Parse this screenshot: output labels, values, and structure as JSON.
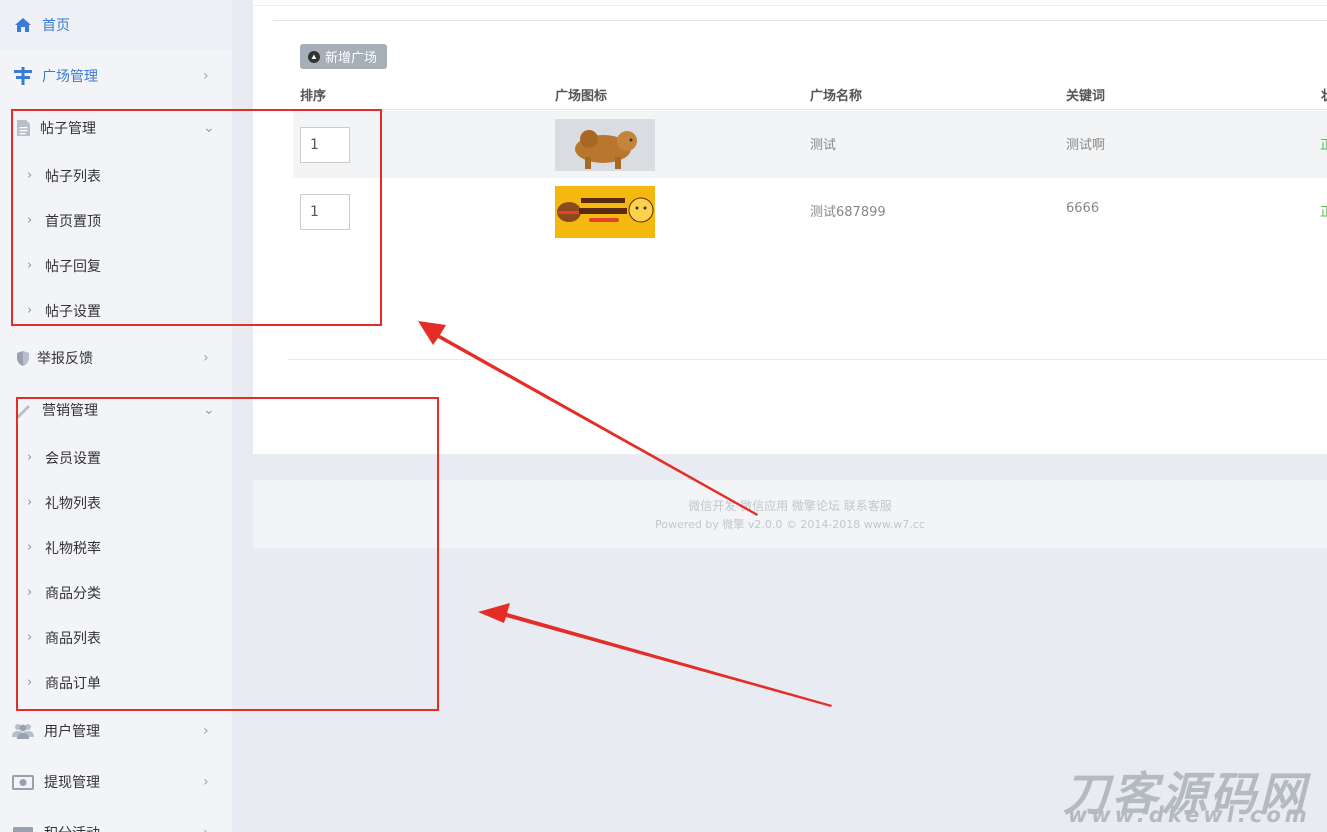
{
  "sidebar": {
    "items": [
      {
        "label": "首页",
        "icon": "home-icon"
      },
      {
        "label": "广场管理",
        "icon": "signpost-icon"
      },
      {
        "label": "帖子管理",
        "icon": "document-icon",
        "children": [
          "帖子列表",
          "首页置顶",
          "帖子回复",
          "帖子设置"
        ]
      },
      {
        "label": "举报反馈",
        "icon": "shield-icon"
      },
      {
        "label": "营销管理",
        "icon": "pen-icon",
        "children": [
          "会员设置",
          "礼物列表",
          "礼物税率",
          "商品分类",
          "商品列表",
          "商品订单"
        ]
      },
      {
        "label": "用户管理",
        "icon": "users-icon"
      },
      {
        "label": "提现管理",
        "icon": "money-icon"
      },
      {
        "label": "积分活动",
        "icon": "card-icon"
      }
    ],
    "arrow_right": "›",
    "arrow_down": "⌄",
    "chev": "›"
  },
  "toolbar": {
    "add_label": "新增广场"
  },
  "table": {
    "columns": [
      "排序",
      "广场图标",
      "广场名称",
      "关键词",
      "状"
    ],
    "rows": [
      {
        "order": "1",
        "name": "测试",
        "keyword": "测试啊",
        "action": "正"
      },
      {
        "order": "1",
        "name": "测试687899",
        "keyword": "6666",
        "action": "正"
      }
    ]
  },
  "footer": {
    "links": "微信开发 微信应用 微擎论坛 联系客服",
    "powered": "Powered by 微擎 v2.0.0 © 2014-2018 www.w7.cc"
  },
  "watermark": {
    "title": "刀客源码网",
    "url": "www.dkewl.com"
  },
  "colors": {
    "accent": "#3a7bd5",
    "annotation": "#e52d27",
    "button": "#a6aeb8"
  }
}
